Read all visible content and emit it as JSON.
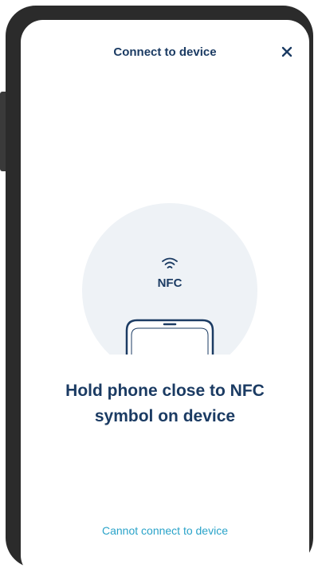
{
  "header": {
    "title": "Connect to device",
    "close_icon": "close-icon"
  },
  "illustration": {
    "nfc_label": "NFC",
    "wave_icon": "nfc-wave-icon",
    "phone_icon": "phone-outline-icon"
  },
  "main": {
    "instruction": "Hold phone close to NFC symbol on device"
  },
  "footer": {
    "link_label": "Cannot connect to device"
  },
  "colors": {
    "text_primary": "#1b3b63",
    "link": "#2aa3c9",
    "circle_background": "#eef2f6",
    "device_frame": "#2b2b2b"
  }
}
